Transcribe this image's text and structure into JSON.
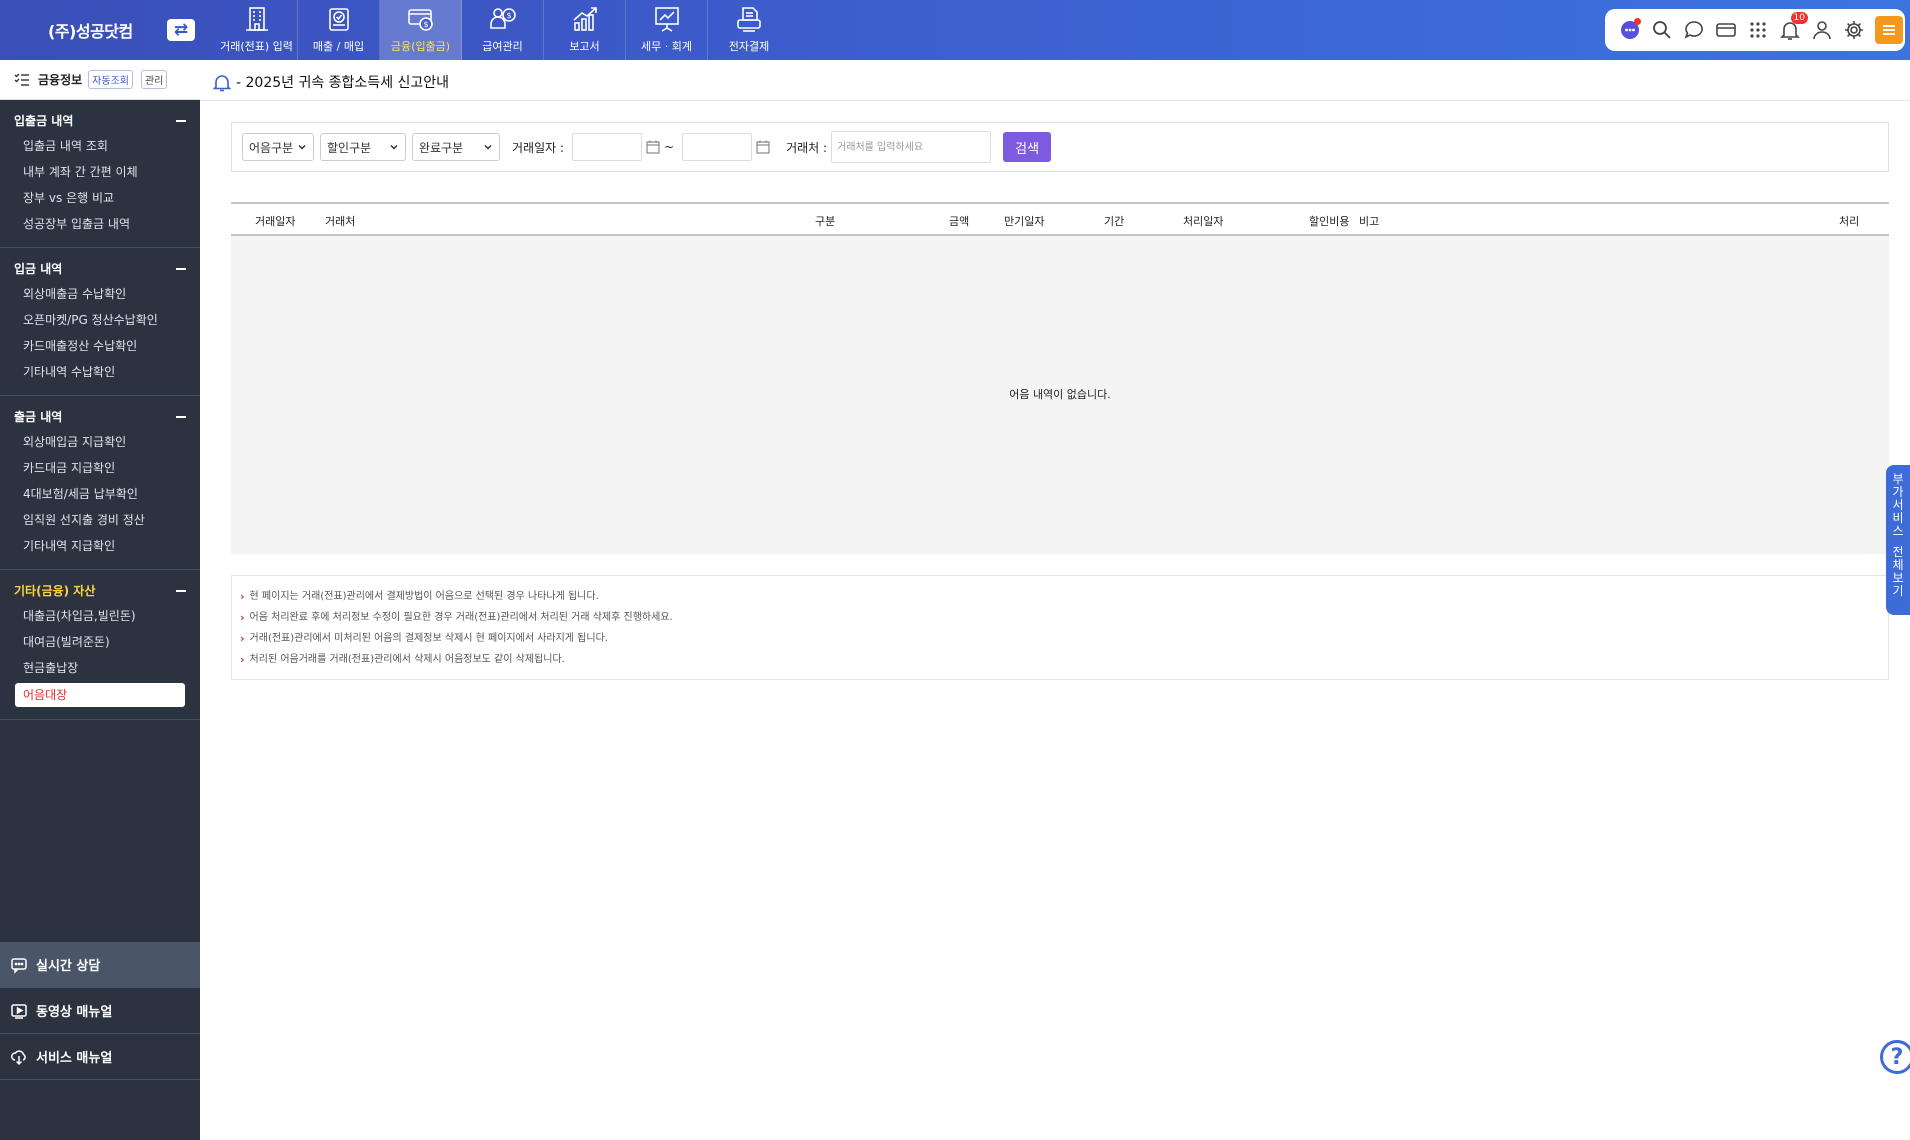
{
  "brand": {
    "name": "(주)성공닷컴",
    "switch_icon": "⇄"
  },
  "nav": {
    "items": [
      {
        "label": "거래(전표) 입력",
        "icon": "building-icon"
      },
      {
        "label": "매출 / 매입",
        "icon": "clipboard-check-icon"
      },
      {
        "label": "금융(입출금)",
        "icon": "card-coin-icon",
        "active": true
      },
      {
        "label": "급여관리",
        "icon": "person-coin-icon"
      },
      {
        "label": "보고서",
        "icon": "growth-chart-icon"
      },
      {
        "label": "세무 · 회계",
        "icon": "presentation-chart-icon"
      },
      {
        "label": "전자결제",
        "icon": "printer-doc-icon"
      }
    ]
  },
  "toolbar": {
    "icons": [
      "chatbot-icon",
      "search-icon",
      "chat-bubble-icon",
      "card-icon",
      "grid-icon",
      "bell-icon",
      "user-icon",
      "gear-icon",
      "hamburger-menu-icon"
    ],
    "notification_count": "10"
  },
  "sidebar": {
    "header": {
      "title": "금융정보",
      "auto_chip": "자동조회",
      "manage_chip": "관리"
    },
    "groups": [
      {
        "title": "입출금 내역",
        "items": [
          "입출금 내역 조회",
          "내부 계좌 간 간편 이체",
          "장부 vs 은행 비교",
          "성공장부 입출금 내역"
        ]
      },
      {
        "title": "입금 내역",
        "items": [
          "외상매출금 수납확인",
          "오픈마켓/PG 정산수납확인",
          "카드매출정산 수납확인",
          "기타내역 수납확인"
        ]
      },
      {
        "title": "출금 내역",
        "items": [
          "외상매입금 지급확인",
          "카드대금 지급확인",
          "4대보험/세금 납부확인",
          "임직원 선지출 경비 정산",
          "기타내역 지급확인"
        ]
      },
      {
        "title": "기타(금융) 자산",
        "items": [
          "대출금(차입금,빌린돈)",
          "대여금(빌려준돈)",
          "현금출납장",
          "어음대장"
        ]
      }
    ],
    "bottom_links": [
      "실시간 상담",
      "동영상 매뉴얼",
      "서비스 매뉴얼"
    ]
  },
  "notice": {
    "text": "- 2025년 귀속 종합소득세 신고안내"
  },
  "filter": {
    "select1": "어음구분",
    "select2": "할인구분",
    "select3": "완료구분",
    "date_label": "거래일자 :",
    "tilde": "~",
    "partner_label": "거래처 :",
    "partner_placeholder": "거래처를 입력하세요",
    "search_button": "검색"
  },
  "table": {
    "headers": [
      "거래일자",
      "거래처",
      "구분",
      "금액",
      "만기일자",
      "기간",
      "처리일자",
      "할인비용",
      "비고",
      "처리"
    ],
    "empty_message": "어음 내역이 없습니다."
  },
  "notes": [
    "현 페이지는 거래(전표)관리에서 결제방법이 어음으로 선택된 경우 나타나게 됩니다.",
    "어음 처리완료 후에 처리정보 수정이 필요한 경우 거래(전표)관리에서 처리된 거래 삭제후 진행하세요.",
    "거래(전표)관리에서 미처리된 어음의 결제정보 삭제시 현 페이지에서 사라지게 됩니다.",
    "처리된 어음거래를 거래(전표)관리에서 삭제시 어음정보도 같이 삭제됩니다."
  ],
  "side_tab": {
    "line1": "부가서비스",
    "line2": "전체보기"
  },
  "help_label": "?"
}
